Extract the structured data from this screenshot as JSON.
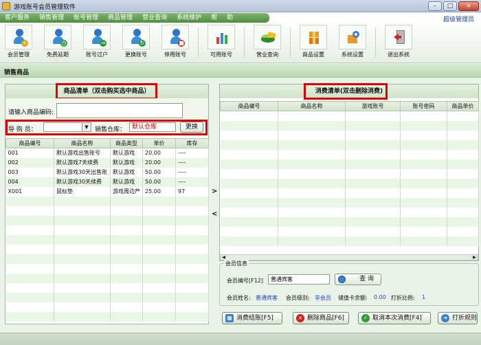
{
  "window": {
    "title": "游戏账号会员管理软件",
    "controls": [
      "-",
      "□",
      "×"
    ]
  },
  "menubar": {
    "items": [
      "客户服务",
      "销售管理",
      "账号管理",
      "商品管理",
      "营业查询",
      "系统维护",
      "帮",
      "助"
    ],
    "user_label": "超级管理员"
  },
  "toolbar": {
    "items": [
      {
        "label": "会员管理",
        "icon": "members-icon"
      },
      {
        "label": "免费延期",
        "icon": "extend-icon"
      },
      {
        "label": "账号过户",
        "icon": "transfer-icon"
      },
      {
        "label": "更换账号",
        "icon": "change-account-icon"
      },
      {
        "label": "停用账号",
        "icon": "disable-account-icon"
      },
      {
        "label": "可用账号",
        "icon": "available-accounts-icon"
      },
      {
        "label": "营业查询",
        "icon": "business-query-icon"
      },
      {
        "label": "商品设置",
        "icon": "goods-settings-icon"
      },
      {
        "label": "系统设置",
        "icon": "system-settings-icon"
      },
      {
        "label": "退出系统",
        "icon": "exit-icon"
      }
    ]
  },
  "section_title": "销售商品",
  "left_panel": {
    "title": "商品清单（双击购买选中商品）",
    "code_label": "请输入商品编码:",
    "code_value": "",
    "guide_label": "导 购 员：",
    "guide_value": "",
    "warehouse_label": "销售仓库：",
    "warehouse_value": "默认仓库",
    "change_button": "更换",
    "columns": [
      "商品编号",
      "商品名称",
      "商品类型",
      "单价",
      "库存"
    ],
    "rows": [
      [
        "001",
        "默认游戏出售账号",
        "默认游戏",
        "20.00",
        "----"
      ],
      [
        "002",
        "默认游戏7天续费",
        "默认游戏",
        "20.00",
        "----"
      ],
      [
        "003",
        "默认游戏30天出售账",
        "默认游戏",
        "50.00",
        "----"
      ],
      [
        "004",
        "默认游戏30天续费",
        "默认游戏",
        "50.00",
        "----"
      ],
      [
        "X001",
        "鼠标垫",
        "游戏周边产",
        "25.00",
        "97"
      ]
    ],
    "empty_rows": 13
  },
  "mid_arrows": [
    ">",
    "<"
  ],
  "right_panel": {
    "title": "消费清单(双击删除消费)",
    "columns": [
      "商品编号",
      "商品名称",
      "游戏账号",
      "账号密码",
      "商品单价"
    ],
    "empty_rows": 14,
    "scroll_left": "◀",
    "scroll_right": "▶"
  },
  "member_info": {
    "legend": "会员信息",
    "id_label": "会员编号[F12]",
    "id_value": "普通宾客",
    "query_button": "查  询",
    "name_label": "会员姓名:",
    "name_value": "普通宾客",
    "level_label": "会员级别:",
    "level_value": "非会员",
    "balance_label": "储值卡余额:",
    "balance_value": "0.00",
    "discount_label": "打折比例:",
    "discount_value": "1"
  },
  "actions": {
    "checkout": "消费结账[F5]",
    "delete": "删除商品[F6]",
    "cancel": "取消本次消费[F4]",
    "print": "打折规则"
  },
  "colors": {
    "menu_green": "#5a9a47",
    "red_highlight": "#e00000",
    "link_blue": "#1b45c8"
  }
}
